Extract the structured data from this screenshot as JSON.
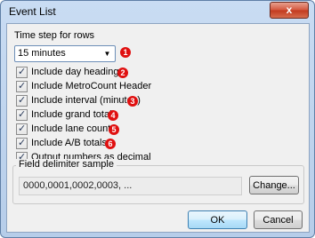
{
  "window": {
    "title": "Event List",
    "close_label": "x"
  },
  "timestep": {
    "label": "Time step for rows",
    "selected": "15 minutes",
    "marker": "1"
  },
  "options": [
    {
      "label": "Include day headings",
      "checked": true,
      "marker": "2"
    },
    {
      "label": "Include MetroCount Header",
      "checked": true,
      "marker": ""
    },
    {
      "label": "Include interval (minutes)",
      "checked": true,
      "marker": "3"
    },
    {
      "label": "Include grand total",
      "checked": true,
      "marker": "4"
    },
    {
      "label": "Include lane counts",
      "checked": true,
      "marker": "5"
    },
    {
      "label": "Include A/B totals",
      "checked": true,
      "marker": "6"
    },
    {
      "label": "Output numbers as decimal",
      "checked": true,
      "marker": ""
    }
  ],
  "delimiter": {
    "legend": "Field delimiter sample",
    "sample": "0000,0001,0002,0003, ...",
    "change_label": "Change..."
  },
  "buttons": {
    "ok": "OK",
    "cancel": "Cancel"
  },
  "colors": {
    "marker": "#e01010",
    "title_bar": "#c9dcf3",
    "close": "#c23a1f"
  }
}
